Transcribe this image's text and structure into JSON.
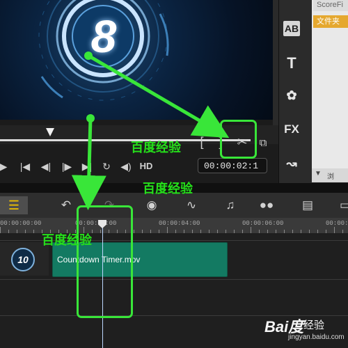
{
  "preview": {
    "countdown_number": "8"
  },
  "library": {
    "items": [
      {
        "label": "ScoreFi"
      },
      {
        "label": "文件夹"
      }
    ],
    "side_icons": {
      "ab": "AB",
      "title": "T",
      "fx": "FX"
    },
    "bottom_label": "浏"
  },
  "player": {
    "scrub_position": 0.2,
    "hd_label": "HD",
    "mark_in": "[",
    "mark_out": "]",
    "timecode": "00:00:02:1"
  },
  "timeline": {
    "ruler_labels": [
      "00:00:00:00",
      "00:00:02:00",
      "00:00:04:00",
      "00:00:06:00",
      "00:00:0"
    ],
    "clip": {
      "label": "Countdown Timer.mov",
      "thumb_number": "10"
    }
  },
  "watermarks": {
    "text": "百度经验",
    "brand_logo": "Bai度",
    "brand_text": "经验",
    "brand_url": "jingyan.baidu.com"
  },
  "colors": {
    "highlight_green": "#39e639",
    "clip_teal": "#137a62",
    "folder_orange": "#e5a82f"
  },
  "icons": [
    "play-icon",
    "home-icon",
    "prev-frame-icon",
    "next-frame-icon",
    "end-icon",
    "repeat-icon",
    "volume-icon",
    "scissors-icon",
    "export-icon",
    "undo-icon",
    "redo-icon",
    "record-icon",
    "audio-wave-icon",
    "music-icon",
    "motion-icon",
    "subtitle-icon"
  ]
}
